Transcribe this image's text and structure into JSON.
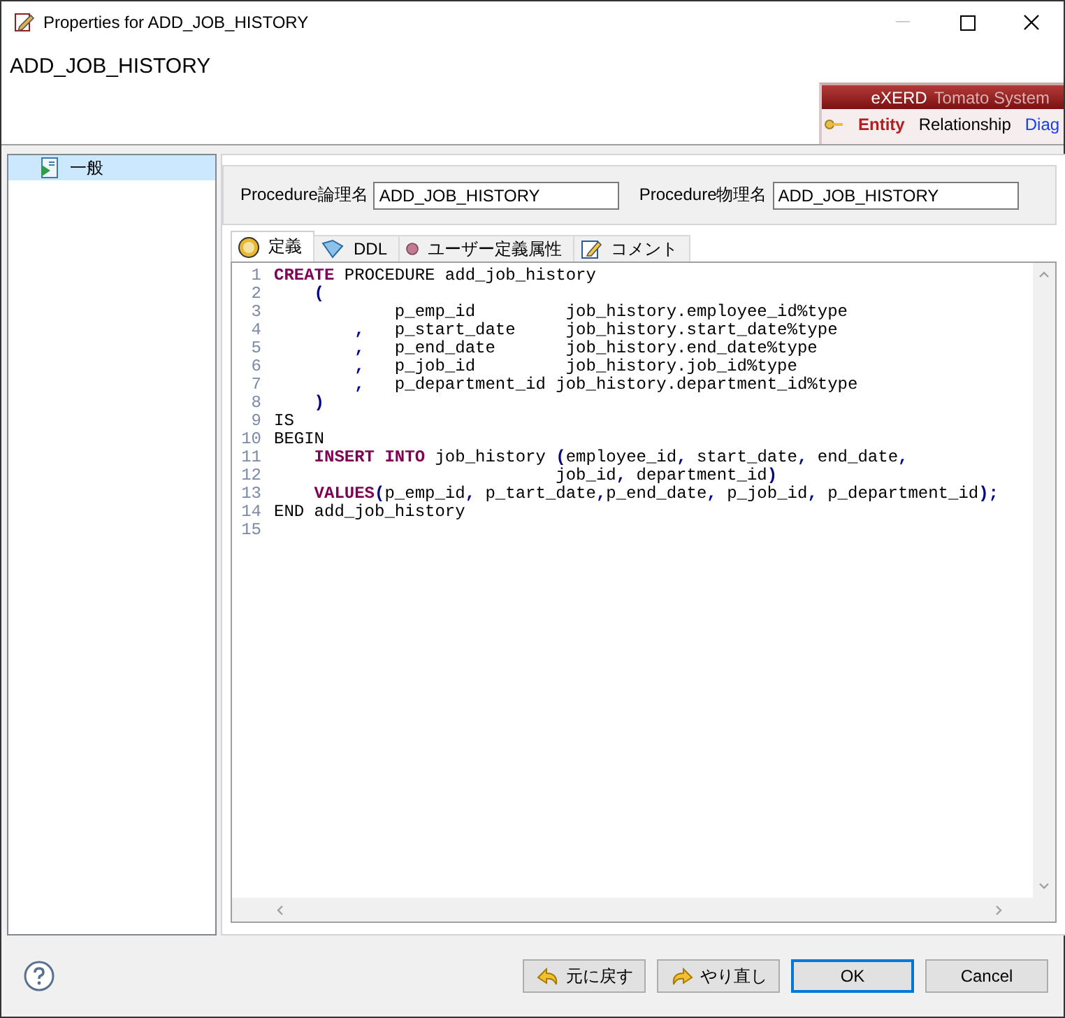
{
  "window": {
    "title": "Properties for ADD_JOB_HISTORY"
  },
  "header": {
    "title": "ADD_JOB_HISTORY",
    "banner": {
      "brand": "eXERD",
      "product": "Tomato System",
      "links": [
        {
          "label": "Entity",
          "selected": true
        },
        {
          "label": "Relationship",
          "selected": false
        },
        {
          "label": "Diag",
          "selected": false
        }
      ]
    }
  },
  "sidebar": {
    "items": [
      {
        "label": "一般",
        "selected": true
      }
    ]
  },
  "fields": [
    {
      "label": "Procedure論理名",
      "value": "ADD_JOB_HISTORY"
    },
    {
      "label": "Procedure物理名",
      "value": "ADD_JOB_HISTORY"
    }
  ],
  "tabs": [
    {
      "label": "定義",
      "kind": "definition",
      "selected": true
    },
    {
      "label": "DDL",
      "kind": "ddl",
      "selected": false
    },
    {
      "label": "ユーザー定義属性",
      "kind": "attribute",
      "selected": false
    },
    {
      "label": "コメント",
      "kind": "comment",
      "selected": false
    }
  ],
  "editor": {
    "lines": [
      {
        "number": "1",
        "tokens": [
          {
            "kind": "keyword",
            "text": "CREATE"
          },
          {
            "kind": "plain",
            "text": " PROCEDURE add_job_history"
          }
        ]
      },
      {
        "number": "2",
        "tokens": [
          {
            "kind": "punct",
            "text": "    ("
          }
        ]
      },
      {
        "number": "3",
        "tokens": [
          {
            "kind": "plain",
            "text": "            p_emp_id         job_history.employee_id%type"
          }
        ]
      },
      {
        "number": "4",
        "tokens": [
          {
            "kind": "punct",
            "text": "        ,"
          },
          {
            "kind": "plain",
            "text": "   p_start_date     job_history.start_date%type"
          }
        ]
      },
      {
        "number": "5",
        "tokens": [
          {
            "kind": "punct",
            "text": "        ,"
          },
          {
            "kind": "plain",
            "text": "   p_end_date       job_history.end_date%type"
          }
        ]
      },
      {
        "number": "6",
        "tokens": [
          {
            "kind": "punct",
            "text": "        ,"
          },
          {
            "kind": "plain",
            "text": "   p_job_id         job_history.job_id%type"
          }
        ]
      },
      {
        "number": "7",
        "tokens": [
          {
            "kind": "punct",
            "text": "        ,"
          },
          {
            "kind": "plain",
            "text": "   p_department_id job_history.department_id%type"
          }
        ]
      },
      {
        "number": "8",
        "tokens": [
          {
            "kind": "punct",
            "text": "    )"
          }
        ]
      },
      {
        "number": "9",
        "tokens": [
          {
            "kind": "plain",
            "text": "IS"
          }
        ]
      },
      {
        "number": "10",
        "tokens": [
          {
            "kind": "plain",
            "text": "BEGIN"
          }
        ]
      },
      {
        "number": "11",
        "tokens": [
          {
            "kind": "keyword",
            "text": "    INSERT INTO"
          },
          {
            "kind": "plain",
            "text": " job_history "
          },
          {
            "kind": "punct",
            "text": "("
          },
          {
            "kind": "plain",
            "text": "employee_id"
          },
          {
            "kind": "punct",
            "text": ","
          },
          {
            "kind": "plain",
            "text": " start_date"
          },
          {
            "kind": "punct",
            "text": ","
          },
          {
            "kind": "plain",
            "text": " end_date"
          },
          {
            "kind": "punct",
            "text": ","
          }
        ]
      },
      {
        "number": "12",
        "tokens": [
          {
            "kind": "plain",
            "text": "                            job_id"
          },
          {
            "kind": "punct",
            "text": ","
          },
          {
            "kind": "plain",
            "text": " department_id"
          },
          {
            "kind": "punct",
            "text": ")"
          }
        ]
      },
      {
        "number": "13",
        "tokens": [
          {
            "kind": "keyword",
            "text": "    VALUES"
          },
          {
            "kind": "punct",
            "text": "("
          },
          {
            "kind": "plain",
            "text": "p_emp_id"
          },
          {
            "kind": "punct",
            "text": ","
          },
          {
            "kind": "plain",
            "text": " p_tart_date"
          },
          {
            "kind": "punct",
            "text": ","
          },
          {
            "kind": "plain",
            "text": "p_end_date"
          },
          {
            "kind": "punct",
            "text": ","
          },
          {
            "kind": "plain",
            "text": " p_job_id"
          },
          {
            "kind": "punct",
            "text": ","
          },
          {
            "kind": "plain",
            "text": " p_department_id"
          },
          {
            "kind": "punct",
            "text": ");"
          }
        ]
      },
      {
        "number": "14",
        "tokens": [
          {
            "kind": "plain",
            "text": "END add_job_history"
          }
        ]
      },
      {
        "number": "15"
      }
    ]
  },
  "buttons": [
    {
      "label": "元に戻す",
      "kind": "undo",
      "default": false
    },
    {
      "label": "やり直し",
      "kind": "redo",
      "default": false
    },
    {
      "label": "OK",
      "kind": "plain",
      "default": true
    },
    {
      "label": "Cancel",
      "kind": "plain",
      "default": false
    }
  ]
}
